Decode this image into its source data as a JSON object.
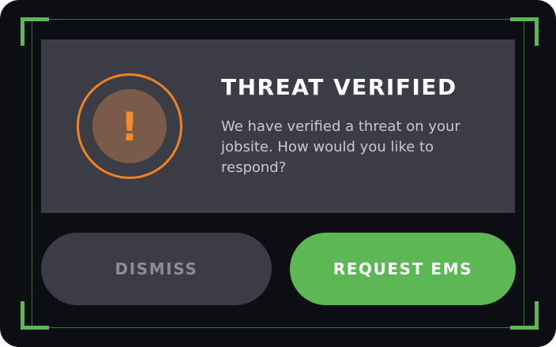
{
  "dialog": {
    "title": "THREAT VERIFIED",
    "message": "We have verified a threat on your jobsite. How would you like to respond?",
    "alert_icon": "exclamation-alert-icon",
    "alert_glyph": "!",
    "colors": {
      "background": "#0c0e14",
      "panel": "#3a3d45",
      "accent_green": "#5bb855",
      "alert_orange": "#f58020"
    }
  },
  "actions": {
    "dismiss_label": "DISMISS",
    "request_ems_label": "REQUEST EMS"
  }
}
